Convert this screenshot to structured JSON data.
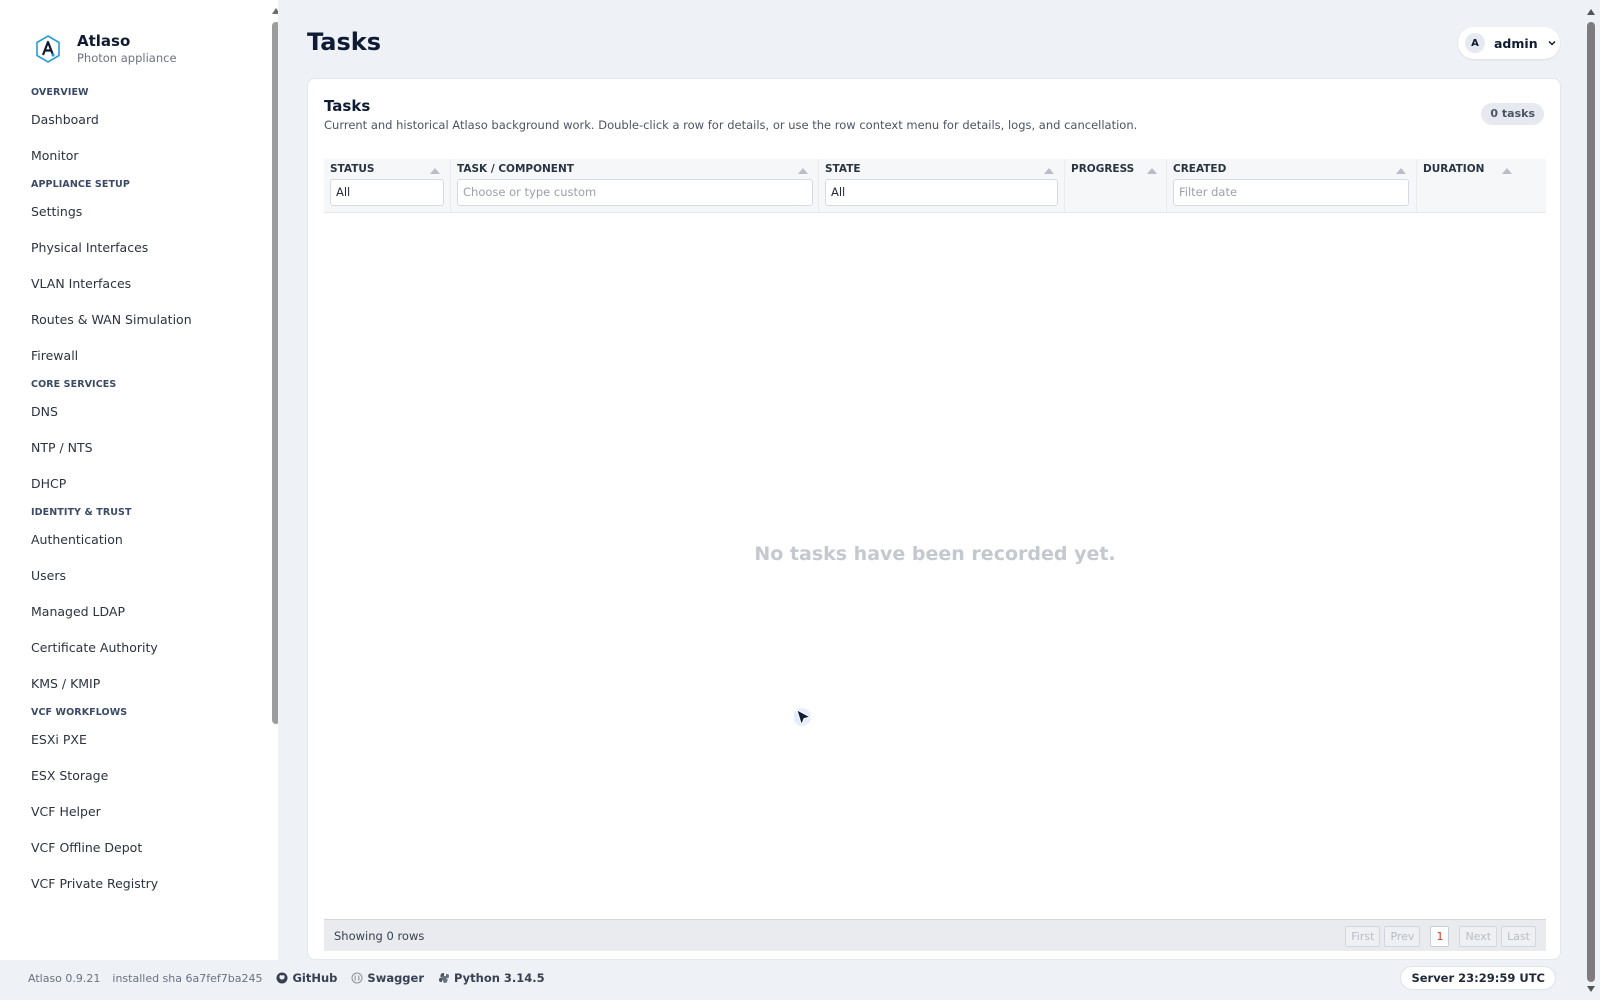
{
  "brand": {
    "name": "Atlaso",
    "subtitle": "Photon appliance"
  },
  "sidebar": {
    "sections": [
      {
        "label": "OVERVIEW",
        "items": [
          "Dashboard",
          "Monitor"
        ]
      },
      {
        "label": "APPLIANCE SETUP",
        "items": [
          "Settings",
          "Physical Interfaces",
          "VLAN Interfaces",
          "Routes & WAN Simulation",
          "Firewall"
        ]
      },
      {
        "label": "CORE SERVICES",
        "items": [
          "DNS",
          "NTP / NTS",
          "DHCP"
        ]
      },
      {
        "label": "IDENTITY & TRUST",
        "items": [
          "Authentication",
          "Users",
          "Managed LDAP",
          "Certificate Authority",
          "KMS / KMIP"
        ]
      },
      {
        "label": "VCF WORKFLOWS",
        "items": [
          "ESXi PXE",
          "ESX Storage",
          "VCF Helper",
          "VCF Offline Depot",
          "VCF Private Registry"
        ]
      }
    ]
  },
  "header": {
    "title": "Tasks",
    "user": {
      "initial": "A",
      "name": "admin"
    }
  },
  "card": {
    "title": "Tasks",
    "description": "Current and historical Atlaso background work. Double-click a row for details, or use the row context menu for details, logs, and cancellation.",
    "count_badge": "0 tasks"
  },
  "table": {
    "columns": {
      "status": {
        "label": "STATUS",
        "filter_value": "All"
      },
      "task": {
        "label": "TASK / COMPONENT",
        "filter_placeholder": "Choose or type custom"
      },
      "state": {
        "label": "STATE",
        "filter_value": "All"
      },
      "progress": {
        "label": "PROGRESS"
      },
      "created": {
        "label": "CREATED",
        "filter_placeholder": "Filter date"
      },
      "duration": {
        "label": "DURATION"
      }
    },
    "empty_message": "No tasks have been recorded yet.",
    "footer": {
      "rows_text": "Showing 0 rows",
      "first": "First",
      "prev": "Prev",
      "current_page": "1",
      "next": "Next",
      "last": "Last"
    }
  },
  "footer": {
    "version": "Atlaso 0.9.21",
    "sha": "installed sha 6a7fef7ba245",
    "github": "GitHub",
    "swagger": "Swagger",
    "python": "Python 3.14.5",
    "server_time": "Server 23:29:59 UTC"
  },
  "colors": {
    "accent": "#0f1b33",
    "page_bg": "#eef1f6",
    "card_bg": "#ffffff",
    "pager_current": "#c0392b"
  }
}
